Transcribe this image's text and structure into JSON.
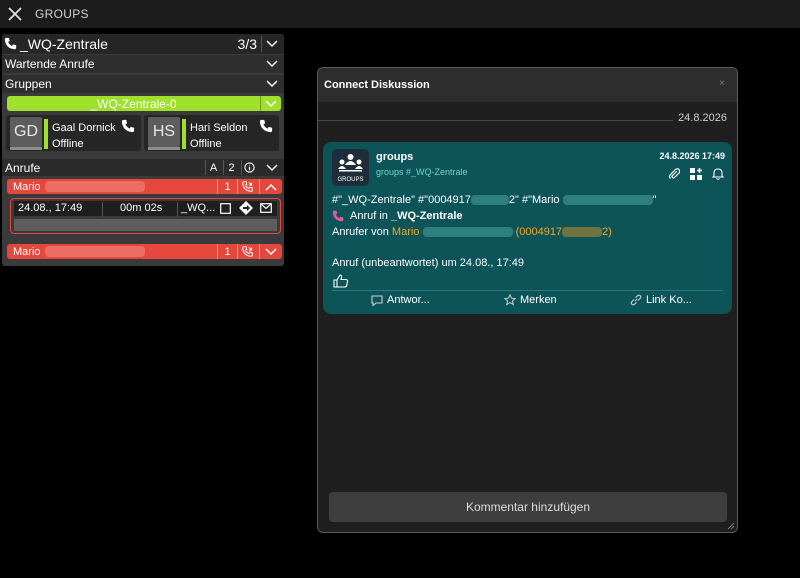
{
  "window": {
    "title": "GROUPS"
  },
  "panel": {
    "group_name": "_WQ-Zentrale",
    "count": "3/3",
    "waiting_label": "Wartende Anrufe",
    "groups_label": "Gruppen",
    "active_group": "_WQ-Zentrale-0",
    "members": [
      {
        "initials": "GD",
        "name": "Gaal Dornick",
        "status": "Offline"
      },
      {
        "initials": "HS",
        "name": "Hari Seldon",
        "status": "Offline"
      }
    ],
    "calls_label": "Anrufe",
    "calls_btn_a": "A",
    "calls_btn_2": "2",
    "calls": [
      {
        "caller": "Mario",
        "count": "1",
        "date": "24.08., 17:49",
        "duration": "00m 02s",
        "target": "_WQ..."
      },
      {
        "caller": "Mario",
        "count": "1"
      }
    ]
  },
  "modal": {
    "title": "Connect Diskussion",
    "close_label": "×",
    "date": "24.8.2026",
    "card": {
      "logo_text": "GROUPS",
      "title": "groups",
      "subtitle": "groups #_WQ-Zentrale",
      "timestamp": "24.8.2026 17:49",
      "line1_a": "#\"_WQ-Zentrale\" #\"0004917",
      "line1_b": "2\" #\"Mario",
      "line1_c": "\"",
      "line2_prefix": "Anruf in ",
      "line2_group": "_WQ-Zentrale",
      "line3_prefix": "Anrufer von ",
      "line3_name": "Mario",
      "line3_num_a": "(0004917",
      "line3_num_b": "2)",
      "line4": "Anruf (unbeantwortet) um 24.08., 17:49",
      "actions": [
        "Antwor...",
        "Merken",
        "Link Ko..."
      ]
    },
    "comment_button": "Kommentar hinzufügen"
  },
  "colors": {
    "green": "#9ee02b",
    "red": "#e5473d",
    "teal": "#0d5459",
    "orange": "#f5a623"
  }
}
